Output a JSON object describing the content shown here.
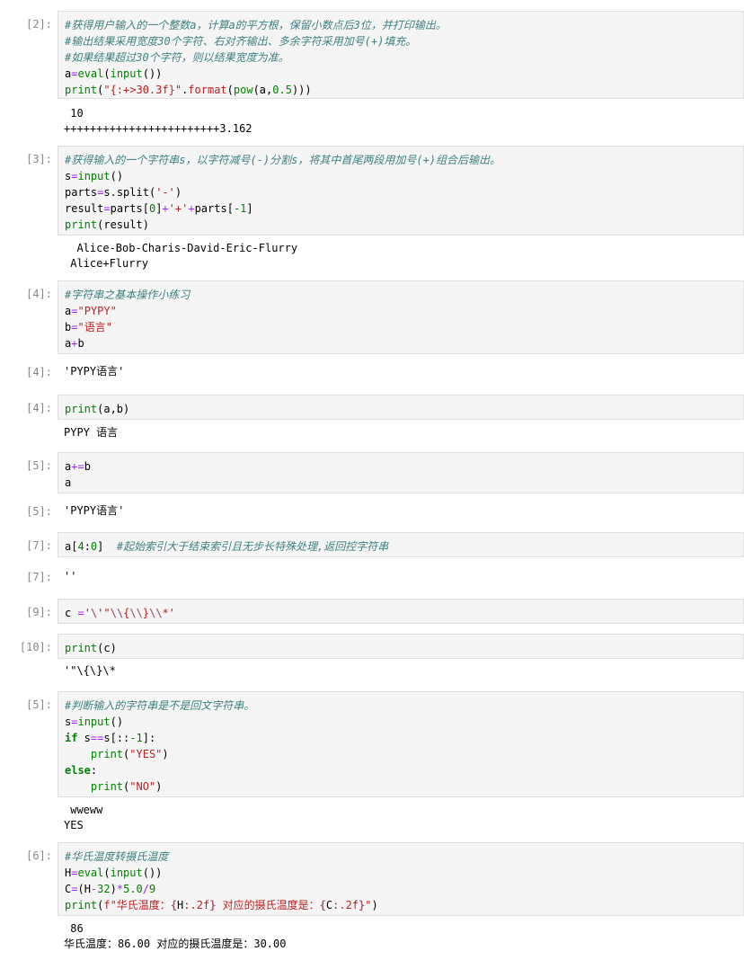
{
  "cells": [
    {
      "prompt": "[2]:",
      "code": [
        [
          {
            "t": "#获得用户输入的一个整数a，计算a的平方根，保留小数点后3位，并打印输出。",
            "c": "cm"
          }
        ],
        [
          {
            "t": "#输出结果采用宽度30个字符、右对齐输出、多余字符采用加号(+)填充。",
            "c": "cm"
          }
        ],
        [
          {
            "t": "#如果结果超过30个字符，则以结果宽度为准。",
            "c": "cm"
          }
        ],
        [
          {
            "t": "a"
          },
          {
            "t": "=",
            "c": "op"
          },
          {
            "t": "eval",
            "c": "bi"
          },
          {
            "t": "("
          },
          {
            "t": "input",
            "c": "bi"
          },
          {
            "t": "())"
          }
        ],
        [
          {
            "t": "print",
            "c": "bi"
          },
          {
            "t": "("
          },
          {
            "t": "\"{:+>30.3f}\"",
            "c": "str"
          },
          {
            "t": "."
          },
          {
            "t": "format",
            "c": "str"
          },
          {
            "t": "("
          },
          {
            "t": "pow",
            "c": "bi"
          },
          {
            "t": "(a,"
          },
          {
            "t": "0.5",
            "c": "num"
          },
          {
            "t": ")))"
          }
        ]
      ],
      "output_lines": [
        " 10",
        "++++++++++++++++++++++++3.162"
      ]
    },
    {
      "prompt": "[3]:",
      "code": [
        [
          {
            "t": "#获得输入的一个字符串s，以字符减号(-)分割s，将其中首尾两段用加号(+)组合后输出。",
            "c": "cm"
          }
        ],
        [
          {
            "t": "s"
          },
          {
            "t": "=",
            "c": "op"
          },
          {
            "t": "input",
            "c": "bi"
          },
          {
            "t": "()"
          }
        ],
        [
          {
            "t": "parts"
          },
          {
            "t": "=",
            "c": "op"
          },
          {
            "t": "s"
          },
          {
            "t": "."
          },
          {
            "t": "split"
          },
          {
            "t": "("
          },
          {
            "t": "'-'",
            "c": "str"
          },
          {
            "t": ")"
          }
        ],
        [
          {
            "t": "result"
          },
          {
            "t": "=",
            "c": "op"
          },
          {
            "t": "parts["
          },
          {
            "t": "0",
            "c": "num"
          },
          {
            "t": "]"
          },
          {
            "t": "+",
            "c": "op"
          },
          {
            "t": "'+'",
            "c": "str"
          },
          {
            "t": "+",
            "c": "op"
          },
          {
            "t": "parts["
          },
          {
            "t": "-1",
            "c": "num"
          },
          {
            "t": "]"
          }
        ],
        [
          {
            "t": "print",
            "c": "bi"
          },
          {
            "t": "(result)"
          }
        ]
      ],
      "output_lines": [
        "  Alice-Bob-Charis-David-Eric-Flurry",
        " Alice+Flurry"
      ]
    },
    {
      "prompt": "[4]:",
      "code": [
        [
          {
            "t": "#字符串之基本操作小练习",
            "c": "cm"
          }
        ],
        [
          {
            "t": "a"
          },
          {
            "t": "=",
            "c": "op"
          },
          {
            "t": "\"PYPY\"",
            "c": "str"
          }
        ],
        [
          {
            "t": "b"
          },
          {
            "t": "=",
            "c": "op"
          },
          {
            "t": "\"语言\"",
            "c": "str"
          }
        ],
        [
          {
            "t": "a"
          },
          {
            "t": "+",
            "c": "op"
          },
          {
            "t": "b"
          }
        ]
      ]
    },
    {
      "out_prompt": "[4]:",
      "output_lines": [
        "'PYPY语言'"
      ]
    },
    {
      "prompt": "[4]:",
      "code": [
        [
          {
            "t": "print",
            "c": "bi"
          },
          {
            "t": "(a,b)"
          }
        ]
      ],
      "output_lines": [
        "PYPY 语言"
      ]
    },
    {
      "prompt": "[5]:",
      "code": [
        [
          {
            "t": "a"
          },
          {
            "t": "+=",
            "c": "op"
          },
          {
            "t": "b"
          }
        ],
        [
          {
            "t": "a"
          }
        ]
      ]
    },
    {
      "out_prompt": "[5]:",
      "output_lines": [
        "'PYPY语言'"
      ]
    },
    {
      "prompt": "[7]:",
      "code": [
        [
          {
            "t": "a["
          },
          {
            "t": "4",
            "c": "num"
          },
          {
            "t": ":"
          },
          {
            "t": "0",
            "c": "num"
          },
          {
            "t": "]  "
          },
          {
            "t": "#起始索引大于结束索引且无步长特殊处理,返回控字符串",
            "c": "cm"
          }
        ]
      ]
    },
    {
      "out_prompt": "[7]:",
      "output_lines": [
        "''"
      ]
    },
    {
      "prompt": "[9]:",
      "code": [
        [
          {
            "t": "c "
          },
          {
            "t": "=",
            "c": "op"
          },
          {
            "t": "'",
            "c": "str"
          },
          {
            "t": "\\'",
            "c": "sa"
          },
          {
            "t": "\"",
            "c": "str"
          },
          {
            "t": "\\\\",
            "c": "sa"
          },
          {
            "t": "{",
            "c": "str"
          },
          {
            "t": "\\\\",
            "c": "sa"
          },
          {
            "t": "}",
            "c": "str"
          },
          {
            "t": "\\\\",
            "c": "sa"
          },
          {
            "t": "*'",
            "c": "str"
          }
        ]
      ]
    },
    {
      "prompt": "[10]:",
      "code": [
        [
          {
            "t": "print",
            "c": "bi"
          },
          {
            "t": "(c)"
          }
        ]
      ],
      "output_lines": [
        "'\"\\{\\}\\*"
      ]
    },
    {
      "prompt": "[5]:",
      "code": [
        [
          {
            "t": "#判断输入的字符串是不是回文字符串。",
            "c": "cm"
          }
        ],
        [
          {
            "t": "s"
          },
          {
            "t": "=",
            "c": "op"
          },
          {
            "t": "input",
            "c": "bi"
          },
          {
            "t": "()"
          }
        ],
        [
          {
            "t": "if",
            "c": "kw"
          },
          {
            "t": " s"
          },
          {
            "t": "==",
            "c": "op"
          },
          {
            "t": "s[::"
          },
          {
            "t": "-1",
            "c": "num"
          },
          {
            "t": "]:"
          }
        ],
        [
          {
            "t": "    "
          },
          {
            "t": "print",
            "c": "bi"
          },
          {
            "t": "("
          },
          {
            "t": "\"YES\"",
            "c": "str"
          },
          {
            "t": ")"
          }
        ],
        [
          {
            "t": "else",
            "c": "kw"
          },
          {
            "t": ":"
          }
        ],
        [
          {
            "t": "    "
          },
          {
            "t": "print",
            "c": "bi"
          },
          {
            "t": "("
          },
          {
            "t": "\"NO\"",
            "c": "str"
          },
          {
            "t": ")"
          }
        ]
      ],
      "output_lines": [
        " wweww",
        "YES"
      ]
    },
    {
      "prompt": "[6]:",
      "code": [
        [
          {
            "t": "#华氏温度转摄氏温度",
            "c": "cm"
          }
        ],
        [
          {
            "t": "H"
          },
          {
            "t": "=",
            "c": "op"
          },
          {
            "t": "eval",
            "c": "bi"
          },
          {
            "t": "("
          },
          {
            "t": "input",
            "c": "bi"
          },
          {
            "t": "())"
          }
        ],
        [
          {
            "t": "C"
          },
          {
            "t": "=",
            "c": "op"
          },
          {
            "t": "(H"
          },
          {
            "t": "-",
            "c": "op"
          },
          {
            "t": "32",
            "c": "num"
          },
          {
            "t": ")"
          },
          {
            "t": "*",
            "c": "op"
          },
          {
            "t": "5.0",
            "c": "num"
          },
          {
            "t": "/",
            "c": "op"
          },
          {
            "t": "9",
            "c": "num"
          }
        ],
        [
          {
            "t": "print",
            "c": "bi"
          },
          {
            "t": "("
          },
          {
            "t": "f\"华氏温度：",
            "c": "str"
          },
          {
            "t": "{",
            "c": "sa"
          },
          {
            "t": "H"
          },
          {
            "t": ":.2f",
            "c": "str"
          },
          {
            "t": "}",
            "c": "sa"
          },
          {
            "t": " 对应的摄氏温度是：",
            "c": "str"
          },
          {
            "t": "{",
            "c": "sa"
          },
          {
            "t": "C"
          },
          {
            "t": ":.2f",
            "c": "str"
          },
          {
            "t": "}",
            "c": "sa"
          },
          {
            "t": "\"",
            "c": "str"
          },
          {
            "t": ")"
          }
        ]
      ],
      "output_lines": [
        " 86",
        "华氏温度：86.00 对应的摄氏温度是：30.00"
      ]
    }
  ],
  "colors": {
    "comment": "#408080",
    "builtin": "#008000",
    "string": "#ba2121",
    "operator": "#aa22ff",
    "keyword": "#008000",
    "prompt": "#888888",
    "input_background": "#f5f5f5"
  }
}
